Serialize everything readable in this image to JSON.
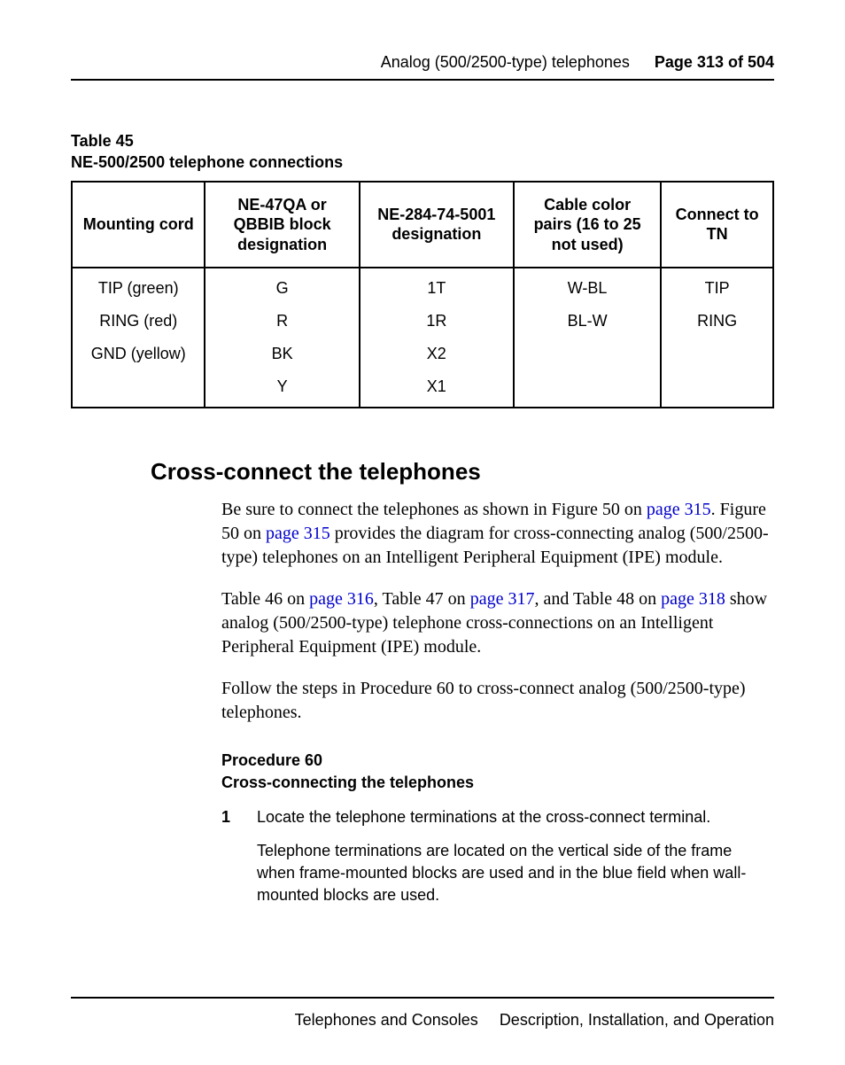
{
  "header": {
    "section": "Analog (500/2500-type) telephones",
    "page_label": "Page 313 of 504"
  },
  "table": {
    "caption_line1": "Table 45",
    "caption_line2": "NE-500/2500 telephone connections",
    "headers": {
      "c1": "Mounting cord",
      "c2": "NE-47QA or QBBIB block designation",
      "c3": "NE-284-74-5001 designation",
      "c4": "Cable color pairs (16 to 25 not used)",
      "c5": "Connect to TN"
    },
    "rows": [
      {
        "c1": "TIP (green)",
        "c2": "G",
        "c3": "1T",
        "c4": "W-BL",
        "c5": "TIP"
      },
      {
        "c1": "RING (red)",
        "c2": "R",
        "c3": "1R",
        "c4": "BL-W",
        "c5": "RING"
      },
      {
        "c1": "GND (yellow)",
        "c2": "BK",
        "c3": "X2",
        "c4": "",
        "c5": ""
      },
      {
        "c1": "",
        "c2": "Y",
        "c3": "X1",
        "c4": "",
        "c5": ""
      }
    ]
  },
  "section": {
    "heading": "Cross-connect the telephones",
    "para1": {
      "t1": "Be sure to connect the telephones as shown in Figure 50 on ",
      "l1": "page 315",
      "t2": ". Figure 50 on ",
      "l2": "page 315",
      "t3": " provides the diagram for cross-connecting analog (500/2500-type) telephones on an Intelligent Peripheral Equipment (IPE) module."
    },
    "para2": {
      "t1": "Table 46 on ",
      "l1": "page 316",
      "t2": ", Table 47 on ",
      "l2": "page 317",
      "t3": ", and Table 48 on ",
      "l3": "page 318",
      "t4": " show analog (500/2500-type) telephone cross-connections on an Intelligent Peripheral Equipment (IPE) module."
    },
    "para3": "Follow the steps in Procedure 60 to cross-connect analog (500/2500-type) telephones.",
    "procedure": {
      "caption_line1": "Procedure 60",
      "caption_line2": "Cross-connecting the telephones",
      "step_num": "1",
      "step_text": "Locate the telephone terminations at the cross-connect terminal.",
      "step_body": "Telephone terminations are located on the vertical side of the frame when frame-mounted blocks are used and in the blue field when wall-mounted blocks are used."
    }
  },
  "footer": {
    "left": "Telephones and Consoles",
    "right": "Description, Installation, and Operation"
  }
}
